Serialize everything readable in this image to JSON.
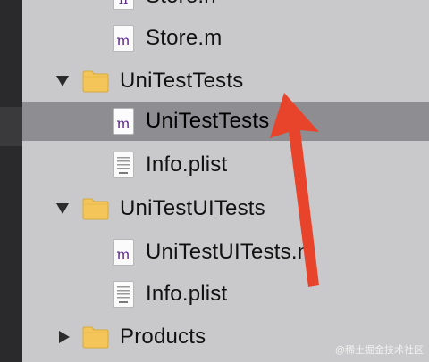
{
  "navigator": {
    "rows": [
      {
        "label": "Store.h",
        "type": "h-file",
        "indent": 2
      },
      {
        "label": "Store.m",
        "type": "m-file",
        "indent": 2
      },
      {
        "label": "UniTestTests",
        "type": "folder",
        "indent": 1,
        "expanded": true
      },
      {
        "label": "UniTestTests",
        "type": "m-file",
        "indent": 2,
        "selected": true
      },
      {
        "label": "Info.plist",
        "type": "plist-file",
        "indent": 2
      },
      {
        "label": "UniTestUITests",
        "type": "folder",
        "indent": 1,
        "expanded": true
      },
      {
        "label": "UniTestUITests.m",
        "type": "m-file",
        "indent": 2
      },
      {
        "label": "Info.plist",
        "type": "plist-file",
        "indent": 2
      },
      {
        "label": "Products",
        "type": "folder",
        "indent": 1,
        "expanded": false
      }
    ],
    "file_glyph_m": "m",
    "file_glyph_h": "h"
  },
  "colors": {
    "background": "#c9c9cb",
    "selected_row": "#8e8e92",
    "folder_fill": "#f4c65a",
    "annotation_arrow": "#e8442b"
  },
  "watermark": "@稀土掘金技术社区"
}
